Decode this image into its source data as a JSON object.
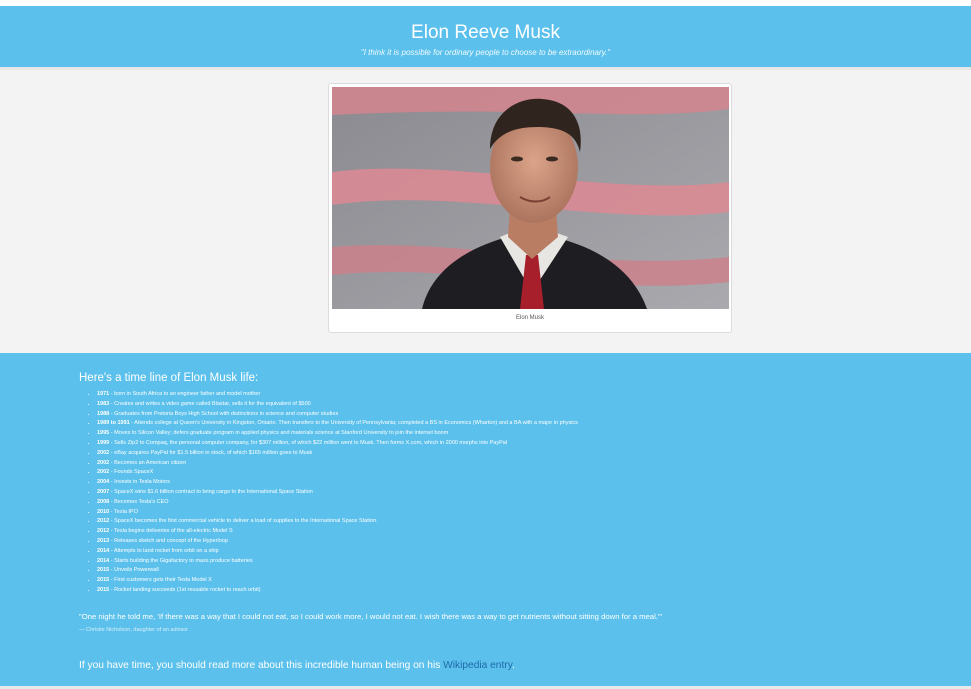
{
  "header": {
    "title": "Elon Reeve Musk",
    "quote": "\"I think it is possible for ordinary people to choose to be extraordinary.\""
  },
  "photo": {
    "caption": "Elon Musk",
    "colors": {
      "background_red": "#d4858e",
      "background_grey": "#a7a7ab",
      "suit": "#1d1d22",
      "shirt": "#e8e6e3",
      "tie": "#a61f2a",
      "skin": "#c99379"
    }
  },
  "timeline": {
    "title": "Here's a time line of Elon Musk life:",
    "events": [
      {
        "year": "1971",
        "text": " - born in South Africa to an engineer father and model mother"
      },
      {
        "year": "1983",
        "text": " - Creates and writes a video game called Blastar, sells it for the equivalent of $500"
      },
      {
        "year": "1988",
        "text": " - Graduates from Pretoria Boys High School with distinctions in science and computer studies"
      },
      {
        "year": "1989 to 1991",
        "text": " - Attends college at Queen's University in Kingston, Ontario. Then transfers to the University of Pennsylvania; completed a BS in Economics (Wharton) and a BA with a major in physics"
      },
      {
        "year": "1995",
        "text": " - Moves to Silicon Valley; defers graduate program in applied physics and materials science at Stanford University to join the internet boom"
      },
      {
        "year": "1999",
        "text": " - Sells Zip2 to Compaq, the personal computer company, for $307 million, of which $22 million went to Musk. Then forms X.com, which in 2000 morphs into PayPal"
      },
      {
        "year": "2002",
        "text": " - eBay acquires PayPal for $1.5 billion in stock, of which $165 million goes to Musk"
      },
      {
        "year": "2002",
        "text": " - Becomes an American citizen"
      },
      {
        "year": "2002",
        "text": " - Founds SpaceX"
      },
      {
        "year": "2004",
        "text": " - Invests in Tesla Motors"
      },
      {
        "year": "2007",
        "text": " - SpaceX wins $1.6 billion contract to bring cargo to the International Space Station"
      },
      {
        "year": "2008",
        "text": " - Becomes Tesla's CEO"
      },
      {
        "year": "2010",
        "text": " - Tesla IPO"
      },
      {
        "year": "2012",
        "text": " - SpaceX becomes the first commercial vehicle to deliver a load of supplies to the International Space Station."
      },
      {
        "year": "2012",
        "text": " - Tesla begins deliveries of the all-electric Model S"
      },
      {
        "year": "2013",
        "text": " - Releases sketch and concept of the Hyperloop"
      },
      {
        "year": "2014",
        "text": " - Attempts to land rocket from orbit on a ship"
      },
      {
        "year": "2014",
        "text": " - Starts building the Gigafactory to mass produce batteries"
      },
      {
        "year": "2015",
        "text": " - Unveils Powerwall"
      },
      {
        "year": "2015",
        "text": " - First customers gets their Tesla Model X"
      },
      {
        "year": "2015",
        "text": " - Rocket landing succeeds (1st reusable rocket to reach orbit)"
      }
    ],
    "quote": "\"One night he told me, 'If there was a way that I could not eat, so I could work more, I would not eat. I wish there was a way to get nutrients without sitting down for a meal.'\"",
    "quote_author": "— Christie Nicholson, daughter of an advisor"
  },
  "footer": {
    "text_before": "If you have time, you should read more about this incredible human being on his ",
    "link_text": "Wikipedia entry",
    "text_after": "."
  },
  "colors": {
    "accent": "#5bc0eb",
    "panel": "#f3f3f3",
    "link": "#1e6aa8"
  }
}
